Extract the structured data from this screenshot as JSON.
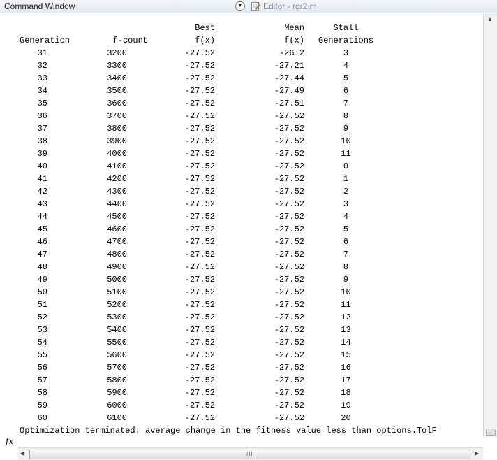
{
  "window": {
    "title": "Command Window",
    "menu_button_glyph": "▼",
    "editor_tab_label": "Editor - rgr2.m"
  },
  "header": {
    "row1": {
      "best": "Best",
      "mean": "Mean",
      "stall": "Stall"
    },
    "row2": {
      "generation": "Generation",
      "fcount": "f-count",
      "best": "f(x)",
      "mean": "f(x)",
      "stall": "Generations"
    }
  },
  "rows": [
    {
      "gen": "31",
      "fcount": "3200",
      "best": "-27.52",
      "mean": "-26.2",
      "stall": "3"
    },
    {
      "gen": "32",
      "fcount": "3300",
      "best": "-27.52",
      "mean": "-27.21",
      "stall": "4"
    },
    {
      "gen": "33",
      "fcount": "3400",
      "best": "-27.52",
      "mean": "-27.44",
      "stall": "5"
    },
    {
      "gen": "34",
      "fcount": "3500",
      "best": "-27.52",
      "mean": "-27.49",
      "stall": "6"
    },
    {
      "gen": "35",
      "fcount": "3600",
      "best": "-27.52",
      "mean": "-27.51",
      "stall": "7"
    },
    {
      "gen": "36",
      "fcount": "3700",
      "best": "-27.52",
      "mean": "-27.52",
      "stall": "8"
    },
    {
      "gen": "37",
      "fcount": "3800",
      "best": "-27.52",
      "mean": "-27.52",
      "stall": "9"
    },
    {
      "gen": "38",
      "fcount": "3900",
      "best": "-27.52",
      "mean": "-27.52",
      "stall": "10"
    },
    {
      "gen": "39",
      "fcount": "4000",
      "best": "-27.52",
      "mean": "-27.52",
      "stall": "11"
    },
    {
      "gen": "40",
      "fcount": "4100",
      "best": "-27.52",
      "mean": "-27.52",
      "stall": "0"
    },
    {
      "gen": "41",
      "fcount": "4200",
      "best": "-27.52",
      "mean": "-27.52",
      "stall": "1"
    },
    {
      "gen": "42",
      "fcount": "4300",
      "best": "-27.52",
      "mean": "-27.52",
      "stall": "2"
    },
    {
      "gen": "43",
      "fcount": "4400",
      "best": "-27.52",
      "mean": "-27.52",
      "stall": "3"
    },
    {
      "gen": "44",
      "fcount": "4500",
      "best": "-27.52",
      "mean": "-27.52",
      "stall": "4"
    },
    {
      "gen": "45",
      "fcount": "4600",
      "best": "-27.52",
      "mean": "-27.52",
      "stall": "5"
    },
    {
      "gen": "46",
      "fcount": "4700",
      "best": "-27.52",
      "mean": "-27.52",
      "stall": "6"
    },
    {
      "gen": "47",
      "fcount": "4800",
      "best": "-27.52",
      "mean": "-27.52",
      "stall": "7"
    },
    {
      "gen": "48",
      "fcount": "4900",
      "best": "-27.52",
      "mean": "-27.52",
      "stall": "8"
    },
    {
      "gen": "49",
      "fcount": "5000",
      "best": "-27.52",
      "mean": "-27.52",
      "stall": "9"
    },
    {
      "gen": "50",
      "fcount": "5100",
      "best": "-27.52",
      "mean": "-27.52",
      "stall": "10"
    },
    {
      "gen": "51",
      "fcount": "5200",
      "best": "-27.52",
      "mean": "-27.52",
      "stall": "11"
    },
    {
      "gen": "52",
      "fcount": "5300",
      "best": "-27.52",
      "mean": "-27.52",
      "stall": "12"
    },
    {
      "gen": "53",
      "fcount": "5400",
      "best": "-27.52",
      "mean": "-27.52",
      "stall": "13"
    },
    {
      "gen": "54",
      "fcount": "5500",
      "best": "-27.52",
      "mean": "-27.52",
      "stall": "14"
    },
    {
      "gen": "55",
      "fcount": "5600",
      "best": "-27.52",
      "mean": "-27.52",
      "stall": "15"
    },
    {
      "gen": "56",
      "fcount": "5700",
      "best": "-27.52",
      "mean": "-27.52",
      "stall": "16"
    },
    {
      "gen": "57",
      "fcount": "5800",
      "best": "-27.52",
      "mean": "-27.52",
      "stall": "17"
    },
    {
      "gen": "58",
      "fcount": "5900",
      "best": "-27.52",
      "mean": "-27.52",
      "stall": "18"
    },
    {
      "gen": "59",
      "fcount": "6000",
      "best": "-27.52",
      "mean": "-27.52",
      "stall": "19"
    },
    {
      "gen": "60",
      "fcount": "6100",
      "best": "-27.52",
      "mean": "-27.52",
      "stall": "20"
    }
  ],
  "termination_message": "Optimization terminated: average change in the fitness value less than options.TolF",
  "prompt_symbol": "fx",
  "scroll": {
    "up_glyph": "▲",
    "left_glyph": "◀",
    "right_glyph": "▶",
    "grip_glyph": "III"
  }
}
